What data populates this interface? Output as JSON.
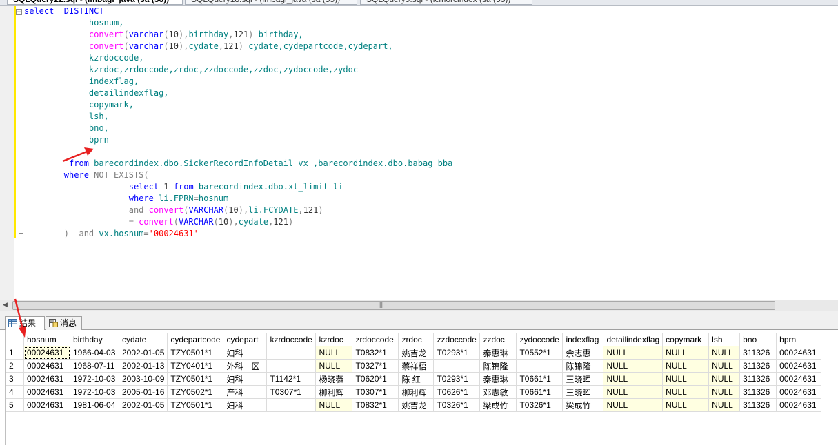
{
  "tabs": [
    {
      "label": "SQLQuery22.sql - (lmbagl_java (sa (56))",
      "active": true
    },
    {
      "label": "SQLQuery18.sql - (lmbagl_java (sa (55))",
      "active": false
    },
    {
      "label": "SQLQuery9.sql - (lcmorcindex (sa (53))",
      "active": false
    }
  ],
  "colors": {
    "keyword": "#0000ff",
    "function": "#ff00ff",
    "operator": "#808080",
    "string": "#ff0000",
    "identifier": "#008080",
    "null_cell": "#ffffe1",
    "change_bar": "#ffe800"
  },
  "icons": [
    "collapse-minus-icon",
    "grid-icon",
    "messages-icon",
    "red-arrow-icon"
  ],
  "sql_lines": [
    [
      {
        "t": "select  DISTINCT",
        "c": "kw"
      }
    ],
    [
      {
        "t": "             hosnum,",
        "c": "id"
      }
    ],
    [
      {
        "t": "             ",
        "c": ""
      },
      {
        "t": "convert",
        "c": "fn"
      },
      {
        "t": "(",
        "c": "gray"
      },
      {
        "t": "varchar",
        "c": "kw"
      },
      {
        "t": "(",
        "c": "gray"
      },
      {
        "t": "10",
        "c": ""
      },
      {
        "t": "),",
        "c": "gray"
      },
      {
        "t": "birthday",
        "c": "id"
      },
      {
        "t": ",",
        "c": "gray"
      },
      {
        "t": "121",
        "c": ""
      },
      {
        "t": ") ",
        "c": "gray"
      },
      {
        "t": "birthday,",
        "c": "id"
      }
    ],
    [
      {
        "t": "             ",
        "c": ""
      },
      {
        "t": "convert",
        "c": "fn"
      },
      {
        "t": "(",
        "c": "gray"
      },
      {
        "t": "varchar",
        "c": "kw"
      },
      {
        "t": "(",
        "c": "gray"
      },
      {
        "t": "10",
        "c": ""
      },
      {
        "t": "),",
        "c": "gray"
      },
      {
        "t": "cydate",
        "c": "id"
      },
      {
        "t": ",",
        "c": "gray"
      },
      {
        "t": "121",
        "c": ""
      },
      {
        "t": ") ",
        "c": "gray"
      },
      {
        "t": "cydate,cydepartcode,cydepart,",
        "c": "id"
      }
    ],
    [
      {
        "t": "             kzrdoccode,",
        "c": "id"
      }
    ],
    [
      {
        "t": "             kzrdoc,zrdoccode,zrdoc,zzdoccode,zzdoc,zydoccode,zydoc",
        "c": "id"
      }
    ],
    [
      {
        "t": "             indexflag,",
        "c": "id"
      }
    ],
    [
      {
        "t": "             detailindexflag,",
        "c": "id"
      }
    ],
    [
      {
        "t": "             copymark,",
        "c": "id"
      }
    ],
    [
      {
        "t": "             lsh,",
        "c": "id"
      }
    ],
    [
      {
        "t": "             bno,",
        "c": "id"
      }
    ],
    [
      {
        "t": "             bprn",
        "c": "id"
      }
    ],
    [
      {
        "t": "",
        "c": ""
      }
    ],
    [
      {
        "t": "         ",
        "c": ""
      },
      {
        "t": "from",
        "c": "kw"
      },
      {
        "t": " barecordindex.dbo.SickerRecordInfoDetail vx ,barecordindex.dbo.babag bba",
        "c": "id"
      }
    ],
    [
      {
        "t": "        ",
        "c": ""
      },
      {
        "t": "where",
        "c": "kw"
      },
      {
        "t": " NOT EXISTS(",
        "c": "gray"
      }
    ],
    [
      {
        "t": "                     ",
        "c": ""
      },
      {
        "t": "select",
        "c": "kw"
      },
      {
        "t": " 1 ",
        "c": ""
      },
      {
        "t": "from",
        "c": "kw"
      },
      {
        "t": " barecordindex.dbo.xt_limit li",
        "c": "id"
      }
    ],
    [
      {
        "t": "                     ",
        "c": ""
      },
      {
        "t": "where",
        "c": "kw"
      },
      {
        "t": " li.FPRN",
        "c": "id"
      },
      {
        "t": "=",
        "c": "gray"
      },
      {
        "t": "hosnum",
        "c": "id"
      }
    ],
    [
      {
        "t": "                     ",
        "c": ""
      },
      {
        "t": "and",
        "c": "gray"
      },
      {
        "t": " ",
        "c": ""
      },
      {
        "t": "convert",
        "c": "fn"
      },
      {
        "t": "(",
        "c": "gray"
      },
      {
        "t": "VARCHAR",
        "c": "kw"
      },
      {
        "t": "(",
        "c": "gray"
      },
      {
        "t": "10",
        "c": ""
      },
      {
        "t": "),",
        "c": "gray"
      },
      {
        "t": "li.FCYDATE",
        "c": "id"
      },
      {
        "t": ",",
        "c": "gray"
      },
      {
        "t": "121",
        "c": ""
      },
      {
        "t": ")",
        "c": "gray"
      }
    ],
    [
      {
        "t": "                     ",
        "c": ""
      },
      {
        "t": "= ",
        "c": "gray"
      },
      {
        "t": "convert",
        "c": "fn"
      },
      {
        "t": "(",
        "c": "gray"
      },
      {
        "t": "VARCHAR",
        "c": "kw"
      },
      {
        "t": "(",
        "c": "gray"
      },
      {
        "t": "10",
        "c": ""
      },
      {
        "t": "),",
        "c": "gray"
      },
      {
        "t": "cydate",
        "c": "id"
      },
      {
        "t": ",",
        "c": "gray"
      },
      {
        "t": "121",
        "c": ""
      },
      {
        "t": ")",
        "c": "gray"
      }
    ],
    [
      {
        "t": "        ",
        "c": ""
      },
      {
        "t": ")",
        "c": "gray"
      },
      {
        "t": "  ",
        "c": ""
      },
      {
        "t": "and",
        "c": "gray"
      },
      {
        "t": " vx.hosnum",
        "c": "id"
      },
      {
        "t": "=",
        "c": "gray"
      },
      {
        "t": "'00024631'",
        "c": "str"
      }
    ]
  ],
  "result_tabs": {
    "results": "结果",
    "messages": "消息"
  },
  "grid": {
    "columns": [
      "hosnum",
      "birthday",
      "cydate",
      "cydepartcode",
      "cydepart",
      "kzrdoccode",
      "kzrdoc",
      "zrdoccode",
      "zrdoc",
      "zzdoccode",
      "zzdoc",
      "zydoccode",
      "indexflag",
      "detailindexflag",
      "copymark",
      "lsh",
      "bno",
      "bprn"
    ],
    "rows": [
      [
        "1",
        "00024631",
        "1966-04-03",
        "2002-01-05",
        "TZY0501*1",
        "妇科",
        "",
        "NULL",
        "T0832*1",
        "姚吉龙",
        "T0293*1",
        "秦惠琳",
        "T0552*1",
        "余志惠",
        "NULL",
        "NULL",
        "NULL",
        "311326",
        "00024631"
      ],
      [
        "2",
        "00024631",
        "1968-07-11",
        "2002-01-13",
        "TZY0401*1",
        "外科一区",
        "",
        "NULL",
        "T0327*1",
        "蔡祥梧",
        "",
        "陈锦隆",
        "",
        "陈锦隆",
        "NULL",
        "NULL",
        "NULL",
        "311326",
        "00024631"
      ],
      [
        "3",
        "00024631",
        "1972-10-03",
        "2003-10-09",
        "TZY0501*1",
        "妇科",
        "T1142*1",
        "杨晓薇",
        "T0620*1",
        "陈  红",
        "T0293*1",
        "秦惠琳",
        "T0661*1",
        "王晓晖",
        "NULL",
        "NULL",
        "NULL",
        "311326",
        "00024631"
      ],
      [
        "4",
        "00024631",
        "1972-10-03",
        "2005-01-16",
        "TZY0502*1",
        "产科",
        "T0307*1",
        "柳利辉",
        "T0307*1",
        "柳利辉",
        "T0626*1",
        "邓志敏",
        "T0661*1",
        "王晓晖",
        "NULL",
        "NULL",
        "NULL",
        "311326",
        "00024631"
      ],
      [
        "5",
        "00024631",
        "1981-06-04",
        "2002-01-05",
        "TZY0501*1",
        "妇科",
        "",
        "NULL",
        "T0832*1",
        "姚吉龙",
        "T0326*1",
        "梁成竹",
        "T0326*1",
        "梁成竹",
        "NULL",
        "NULL",
        "NULL",
        "311326",
        "00024631"
      ]
    ]
  }
}
